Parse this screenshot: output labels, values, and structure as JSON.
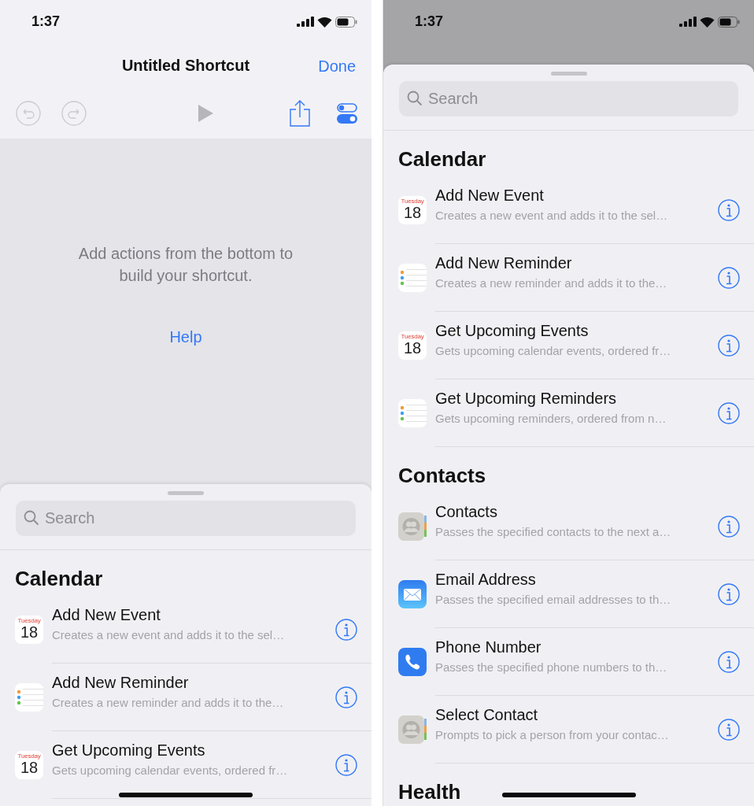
{
  "screens": [
    {
      "dimmed": false,
      "status_bar": {
        "time": "1:37"
      },
      "nav": {
        "title": "Untitled Shortcut",
        "done": "Done"
      },
      "toolbar": [
        {
          "kind": "undo",
          "disabled": true
        },
        {
          "kind": "redo",
          "disabled": true
        },
        {
          "kind": "play",
          "disabled": true
        },
        {
          "kind": "share",
          "disabled": false
        },
        {
          "kind": "settings",
          "disabled": false
        }
      ],
      "empty_state": {
        "message": "Add actions from the bottom to build your shortcut.",
        "help": "Help"
      },
      "sheet": {
        "search": {
          "placeholder": "Search"
        },
        "sections": [
          {
            "title": "Calendar",
            "actions": [
              {
                "kind": "calendar",
                "icon_day": "Tuesday",
                "icon_date": "18",
                "title": "Add New Event",
                "description": "Creates a new event and adds it to the sel…"
              },
              {
                "kind": "reminders",
                "title": "Add New Reminder",
                "description": "Creates a new reminder and adds it to the…"
              },
              {
                "kind": "calendar",
                "icon_day": "Tuesday",
                "icon_date": "18",
                "title": "Get Upcoming Events",
                "description": "Gets upcoming calendar events, ordered fr…"
              }
            ]
          }
        ]
      }
    },
    {
      "dimmed": true,
      "status_bar": {
        "time": "1:37"
      },
      "sheet": {
        "search": {
          "placeholder": "Search"
        },
        "sections": [
          {
            "title": "Calendar",
            "actions": [
              {
                "kind": "calendar",
                "icon_day": "Tuesday",
                "icon_date": "18",
                "title": "Add New Event",
                "description": "Creates a new event and adds it to the sel…"
              },
              {
                "kind": "reminders",
                "title": "Add New Reminder",
                "description": "Creates a new reminder and adds it to the…"
              },
              {
                "kind": "calendar",
                "icon_day": "Tuesday",
                "icon_date": "18",
                "title": "Get Upcoming Events",
                "description": "Gets upcoming calendar events, ordered fr…"
              },
              {
                "kind": "reminders",
                "title": "Get Upcoming Reminders",
                "description": "Gets upcoming reminders, ordered from n…"
              }
            ]
          },
          {
            "title": "Contacts",
            "actions": [
              {
                "kind": "contacts",
                "title": "Contacts",
                "description": "Passes the specified contacts to the next a…"
              },
              {
                "kind": "mail",
                "title": "Email Address",
                "description": "Passes the specified email addresses to th…"
              },
              {
                "kind": "phone",
                "title": "Phone Number",
                "description": "Passes the specified phone numbers to th…"
              },
              {
                "kind": "contacts",
                "title": "Select Contact",
                "description": "Prompts to pick a person from your contac…"
              }
            ]
          },
          {
            "title": "Health"
          }
        ]
      }
    }
  ]
}
